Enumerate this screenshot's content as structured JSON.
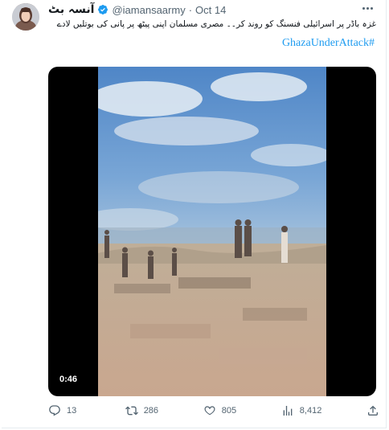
{
  "tweet": {
    "author": {
      "display_name": "آنسہ بٹ",
      "handle": "@iamansaarmy",
      "verified": true
    },
    "separator": "·",
    "timestamp": "Oct 14",
    "text": "غزہ باڈر پر اسرائیلی فنسنگ کو روند کر۔۔ مصری مسلمان اپنی پیٹھ پر پانی کی بوتلیں لادے کے۔۔ غزہ شہر کی طرف بڑھ رہے ہیں",
    "hashtag": "GhazaUnderAttack#",
    "video": {
      "duration": "0:46"
    },
    "actions": {
      "replies": "13",
      "retweets": "286",
      "likes": "805",
      "views": "8,412"
    }
  },
  "colors": {
    "link": "#1d9bf0",
    "secondary_text": "#536471",
    "primary_text": "#0f1419",
    "verified_badge": "#1d9bf0"
  },
  "icons": {
    "reply": "reply-icon",
    "retweet": "retweet-icon",
    "like": "heart-icon",
    "views": "views-chart-icon",
    "share": "share-icon",
    "more": "more-options-icon",
    "verified": "verified-badge-icon"
  }
}
